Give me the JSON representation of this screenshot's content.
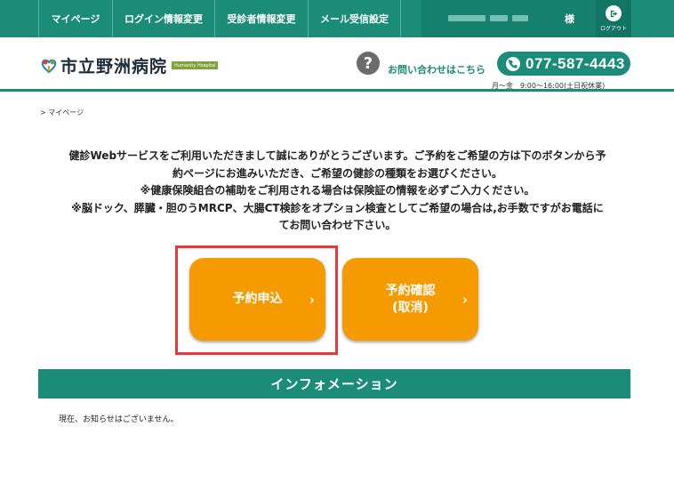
{
  "nav": {
    "items": [
      {
        "label": "マイページ"
      },
      {
        "label": "ログイン情報変更"
      },
      {
        "label": "受診者情報変更"
      },
      {
        "label": "メール受信設定"
      }
    ],
    "user_suffix": "様",
    "logout_label": "ログアウト"
  },
  "header": {
    "logo_text": "市立野洲病院",
    "logo_badge": "Humanity Hospital",
    "contact_label": "お問い合わせはこちら",
    "phone": "077-587-4443",
    "hours": "月～金　9:00～16:00(土日祝休業)"
  },
  "breadcrumb": "> マイページ",
  "intro": {
    "line1": "健診Webサービスをご利用いただきまして誠にありがとうございます。ご予約をご希望の方は下のボタンから予",
    "line2": "約ページにお進みいただき、ご希望の健診の種類をお選びください。",
    "line3": "※健康保険組合の補助をご利用される場合は保険証の情報を必ずご入力ください。",
    "line4": "※脳ドック、膵臓・胆のうMRCP、大腸CT検診をオプション検査としてご希望の場合は,お手数ですがお電話に",
    "line5": "てお問い合わせ下さい。"
  },
  "buttons": {
    "reserve_label": "予約申込",
    "confirm_label_1": "予約確認",
    "confirm_label_2": "(取消)"
  },
  "info": {
    "title": "インフォメーション",
    "text": "現在、お知らせはございません。"
  },
  "colors": {
    "brand": "#1a8c78",
    "button": "#f59a00",
    "highlight": "#e8383d"
  }
}
